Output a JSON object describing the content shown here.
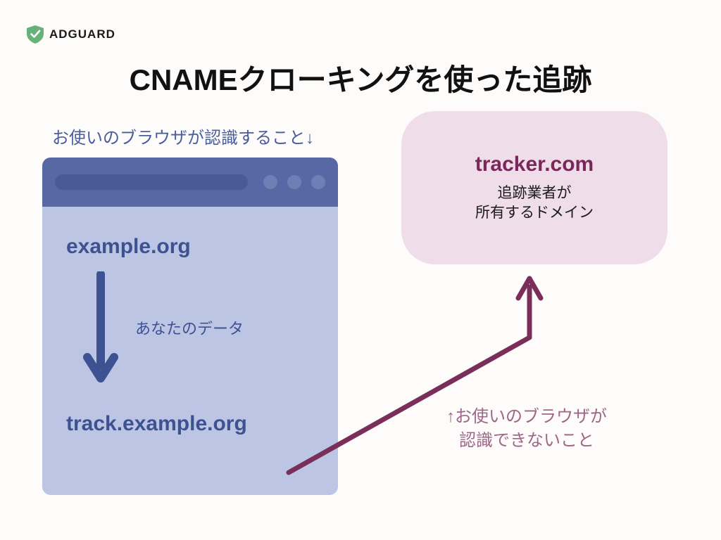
{
  "brand": {
    "name": "ADGUARD"
  },
  "title": "CNAMEクローキングを使った追跡",
  "browser_subtitle": "お使いのブラウザが認識すること↓",
  "browser": {
    "visited_domain": "example.org",
    "data_arrow_label": "あなたのデータ",
    "tracking_subdomain": "track.example.org"
  },
  "tracker": {
    "domain": "tracker.com",
    "description_line1": "追跡業者が",
    "description_line2": "所有するドメイン"
  },
  "hidden_label_line1": "↑お使いのブラウザが",
  "hidden_label_line2": "認識できないこと",
  "colors": {
    "browser_accent": "#3e5190",
    "browser_bg": "#bcc6e4",
    "browser_bar": "#5868a5",
    "tracker_bg": "#efdee9",
    "tracker_accent": "#7a2859",
    "hidden_text": "#9e6688",
    "brand_green": "#67b279"
  }
}
